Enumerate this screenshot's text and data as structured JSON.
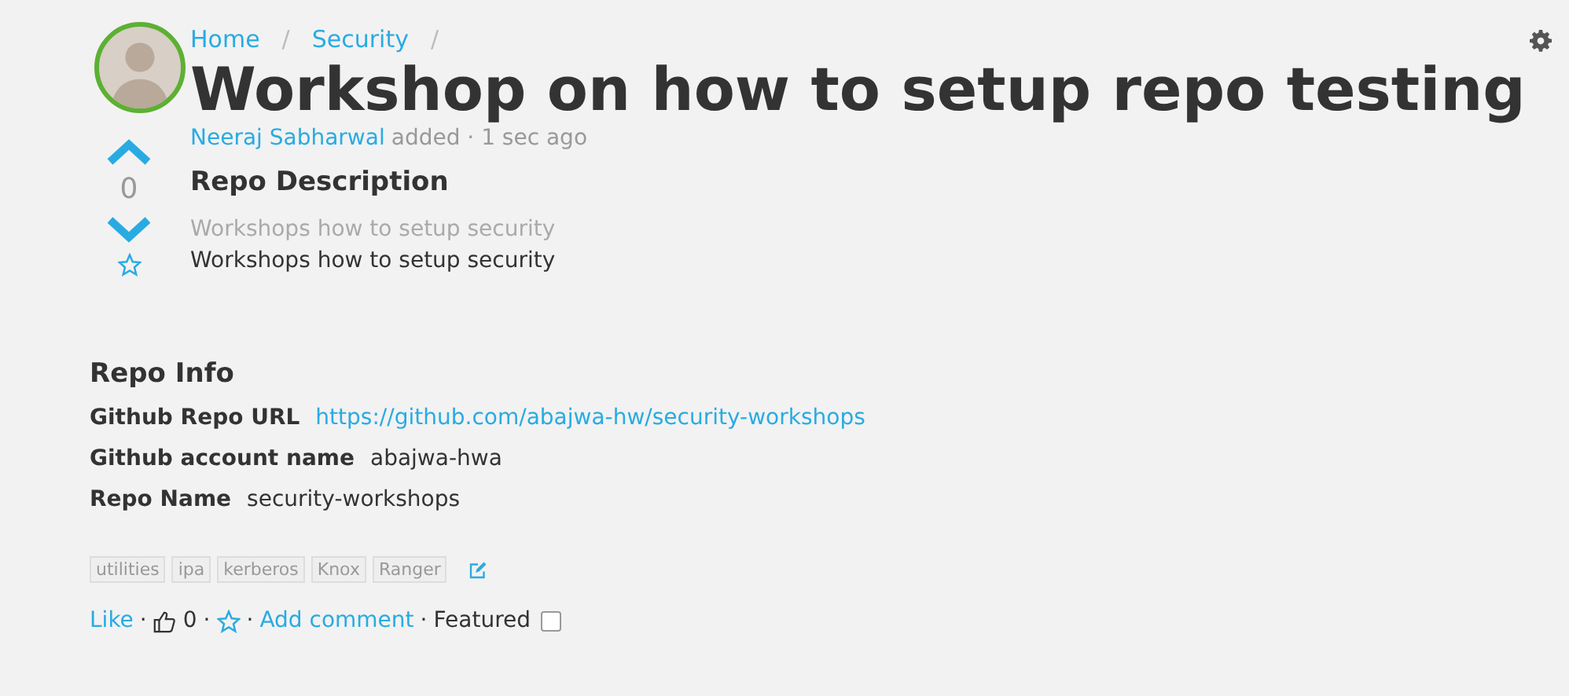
{
  "breadcrumb": [
    {
      "label": "Home"
    },
    {
      "label": "Security"
    }
  ],
  "breadcrumb_separator": [
    "/",
    "/"
  ],
  "title": "Workshop on how to setup repo testing",
  "byline": {
    "author": "Neeraj Sabharwal",
    "meta": "added · 1 sec ago"
  },
  "vote": {
    "count": "0"
  },
  "description": {
    "heading": "Repo Description",
    "lines": [
      {
        "kind": "muted",
        "text": "Workshops how to setup security"
      },
      {
        "kind": "normal",
        "text": "Workshops how to setup security"
      }
    ]
  },
  "repo_info": {
    "heading": "Repo Info",
    "fields": [
      {
        "kind": "link",
        "label": "Github Repo URL",
        "value": "https://github.com/abajwa-hw/security-workshops"
      },
      {
        "kind": "text",
        "label": "Github account name",
        "value": "abajwa-hwa"
      },
      {
        "kind": "text",
        "label": "Repo Name",
        "value": "security-workshops"
      }
    ]
  },
  "tags": [
    "utilities",
    "ipa",
    "kerberos",
    "Knox",
    "Ranger"
  ],
  "footer": [
    {
      "kind": "link",
      "text": "Like"
    },
    {
      "kind": "sep",
      "text": "·"
    },
    {
      "kind": "likes",
      "text": "0"
    },
    {
      "kind": "sep",
      "text": "·"
    },
    {
      "kind": "star"
    },
    {
      "kind": "sep",
      "text": "·"
    },
    {
      "kind": "link",
      "text": "Add comment"
    },
    {
      "kind": "sep",
      "text": "·"
    },
    {
      "kind": "text",
      "text": "Featured"
    },
    {
      "kind": "checkbox",
      "checked": false
    }
  ]
}
